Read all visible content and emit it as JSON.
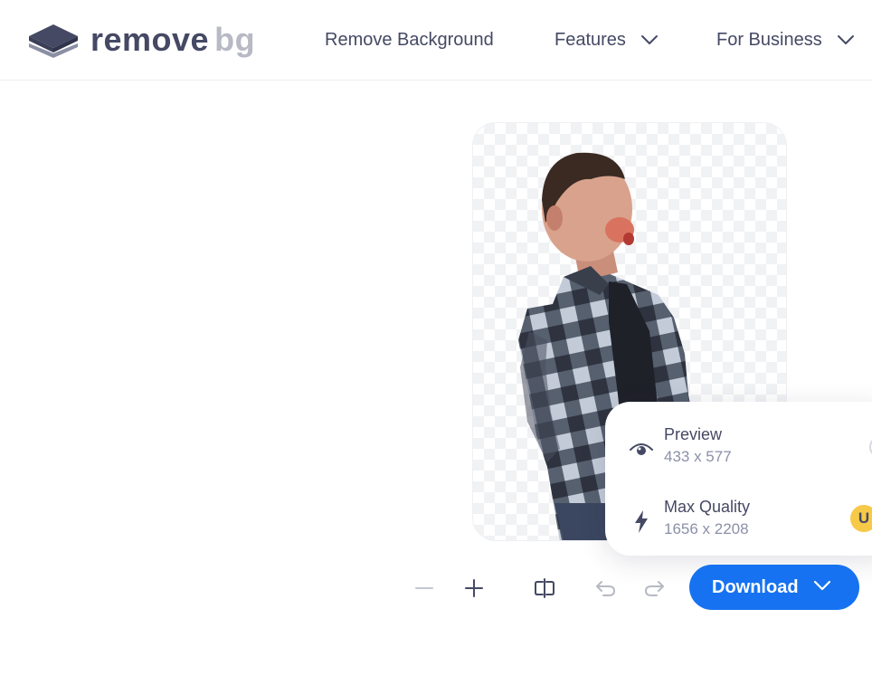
{
  "header": {
    "logo": {
      "word1": "remove",
      "word2": "bg",
      "icon": "layers-logo-icon"
    },
    "nav": [
      {
        "label": "Remove Background",
        "has_dropdown": false
      },
      {
        "label": "Features",
        "has_dropdown": true,
        "icon": "chevron-down-icon"
      },
      {
        "label": "For Business",
        "has_dropdown": true,
        "icon": "chevron-down-icon"
      }
    ]
  },
  "editor": {
    "canvas": {
      "background": "transparent-checkerboard",
      "subject": "person-cutout"
    },
    "toolbar": {
      "zoom_out_icon": "minus-icon",
      "zoom_in_icon": "plus-icon",
      "compare_icon": "compare-split-icon",
      "undo_icon": "undo-icon",
      "redo_icon": "redo-icon"
    },
    "download": {
      "label": "Download",
      "icon": "chevron-down-icon",
      "color": "#1672f0"
    }
  },
  "download_menu": {
    "items": [
      {
        "title": "Preview",
        "size": "433 x 577",
        "icon": "eye-icon",
        "control": "radio"
      },
      {
        "title": "Max Quality",
        "size": "1656 x 2208",
        "icon": "lightning-icon",
        "badge": "U",
        "badge_color": "#f7c948"
      }
    ]
  },
  "colors": {
    "text": "#454964",
    "muted": "#8b90a8",
    "accent": "#1672f0"
  }
}
